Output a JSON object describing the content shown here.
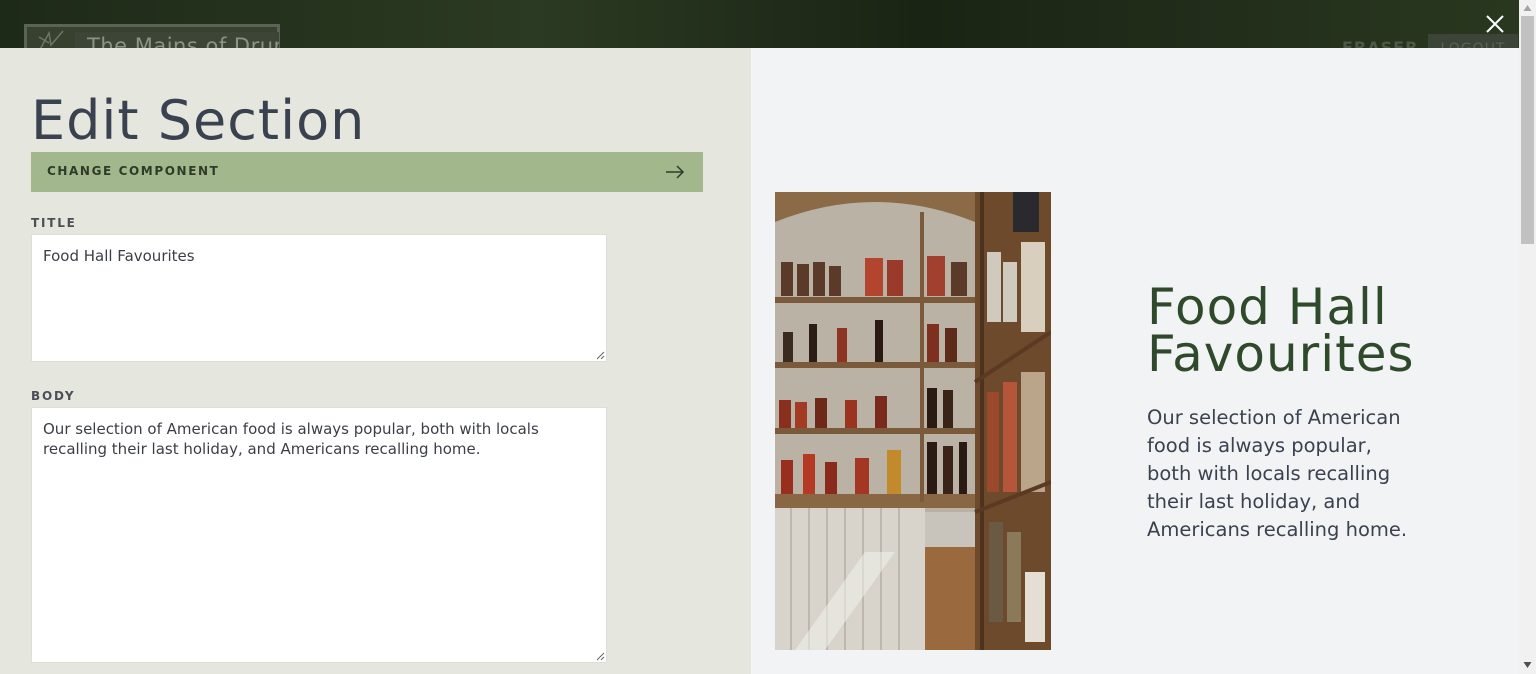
{
  "background": {
    "site_title": "The Mains of Drum",
    "user_name": "FRASER",
    "logout_label": "LOGOUT"
  },
  "modal": {
    "title": "Edit Section",
    "change_component_label": "CHANGE COMPONENT",
    "fields": {
      "title_label": "TITLE",
      "title_value": "Food Hall Favourites",
      "body_label": "BODY",
      "body_value": "Our selection of American food is always popular, both with locals recalling their last holiday, and Americans recalling home."
    },
    "preview": {
      "title": "Food Hall Favourites",
      "body": "Our selection of American food is always popular, both with locals recalling their last holiday, and Americans recalling home."
    }
  },
  "icons": {
    "close": "close-icon",
    "arrow": "arrow-right-icon",
    "resize": "resize-handle-icon",
    "logo": "logo-icon"
  },
  "colors": {
    "left_panel": "#e5e7df",
    "accent_button": "#a3b78c",
    "preview_title": "#2f4a2a",
    "text_dark": "#3a4250"
  }
}
